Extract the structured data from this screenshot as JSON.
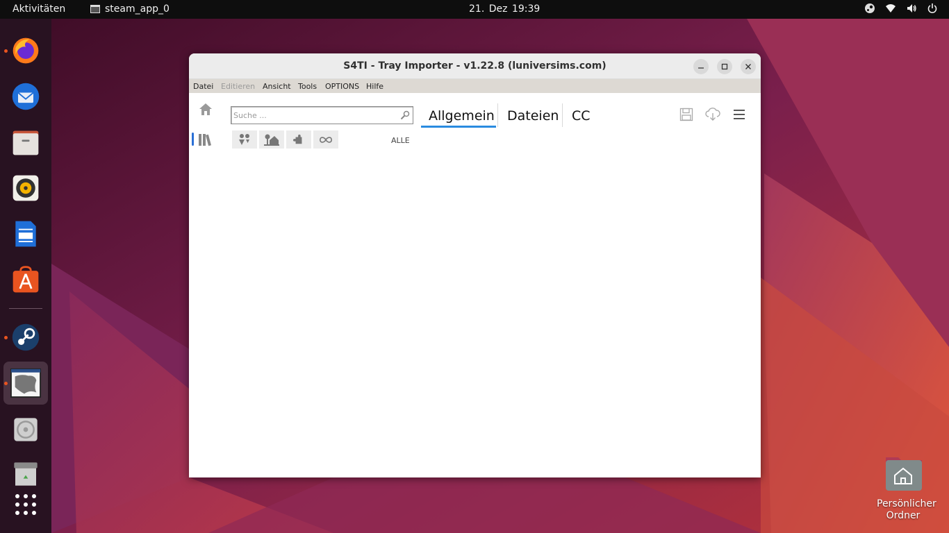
{
  "topbar": {
    "activities": "Aktivitäten",
    "app_name": "steam_app_0",
    "clock": "21. Dez  19:39",
    "tray_icons": [
      "steam-icon",
      "wifi-icon",
      "volume-icon",
      "power-icon"
    ]
  },
  "dock": {
    "apps": [
      {
        "name": "firefox",
        "running": true
      },
      {
        "name": "thunderbird",
        "running": false
      },
      {
        "name": "files",
        "running": false
      },
      {
        "name": "rhythmbox",
        "running": false
      },
      {
        "name": "libreoffice-writer",
        "running": false
      },
      {
        "name": "ubuntu-software",
        "running": false
      },
      {
        "name": "steam",
        "running": true
      },
      {
        "name": "s4ti-window",
        "running": true,
        "active": true
      },
      {
        "name": "disc-drive",
        "running": false
      },
      {
        "name": "trash",
        "running": false
      },
      {
        "name": "show-applications",
        "running": false
      }
    ]
  },
  "window": {
    "title": "S4TI - Tray Importer - v1.22.8  (luniversims.com)",
    "menu": {
      "datei": "Datei",
      "editieren": "Editieren",
      "ansicht": "Ansicht",
      "tools": "Tools",
      "options": "OPTIONS",
      "hilfe": "Hilfe"
    },
    "search": {
      "placeholder": "Suche ...",
      "value": ""
    },
    "filters": [
      "sims-filter",
      "lots-filter",
      "puzzle-filter",
      "infinity-filter"
    ],
    "filter_label": "ALLE",
    "tabs": {
      "allgemein": "Allgemein",
      "dateien": "Dateien",
      "cc": "CC"
    },
    "active_tab": "Allgemein",
    "accent_color": "#2a8be0"
  },
  "desktop": {
    "home_folder_label_line1": "Persönlicher",
    "home_folder_label_line2": "Ordner"
  }
}
